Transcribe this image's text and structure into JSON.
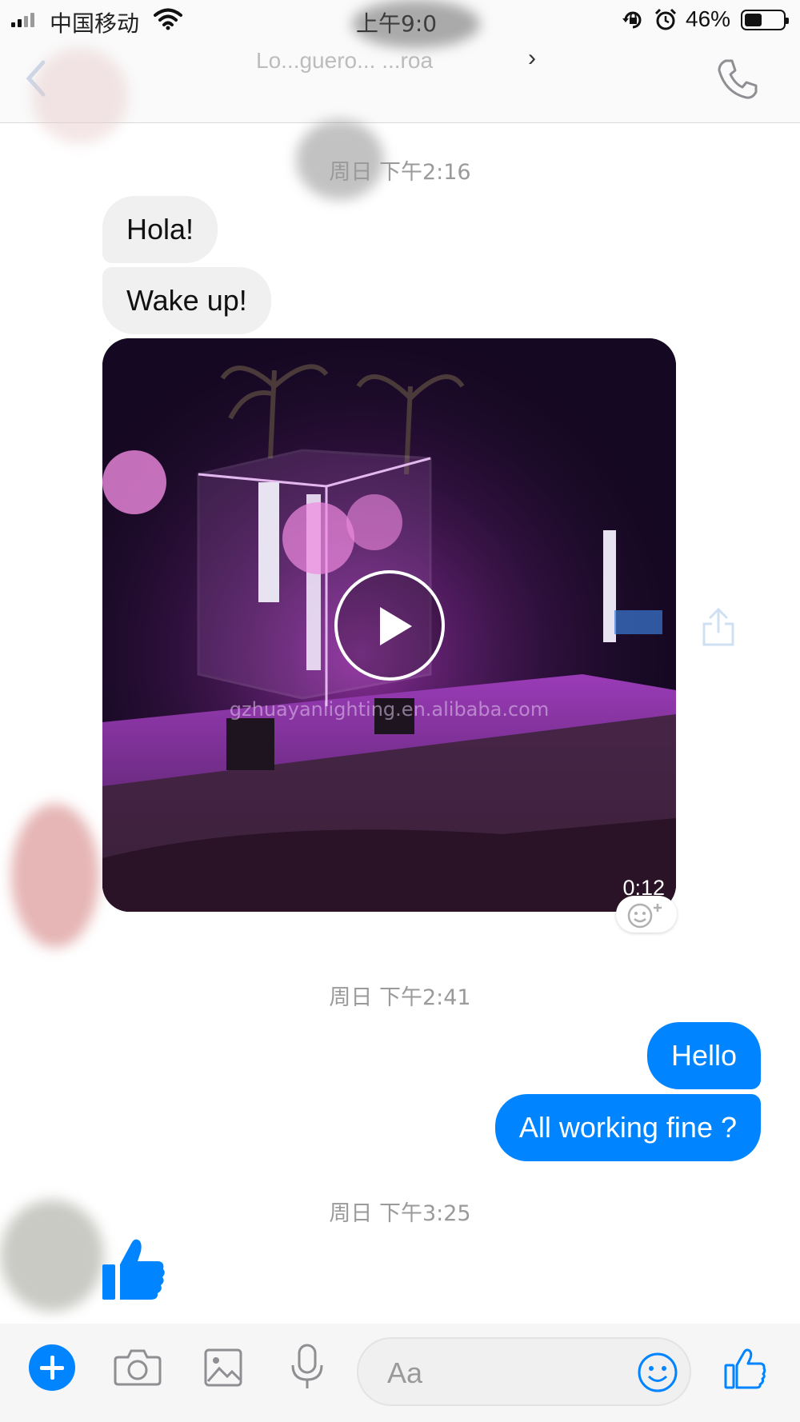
{
  "status_bar": {
    "carrier": "中国移动",
    "time": "上午9:0",
    "battery_percent": "46%",
    "battery_level": 0.46
  },
  "nav": {
    "contact_name": "Lo...guero... ...roa",
    "chevron": "›"
  },
  "messages": {
    "timestamp_1": "周日 下午2:16",
    "incoming_1": "Hola!",
    "incoming_2": "Wake up!",
    "video": {
      "duration": "0:12",
      "watermark": "gzhuayanlighting.en.alibaba.com"
    },
    "timestamp_2": "周日 下午2:41",
    "outgoing_1": "Hello",
    "outgoing_2": "All working fine ?",
    "timestamp_3": "周日 下午3:25"
  },
  "composer": {
    "placeholder": "Aa"
  },
  "colors": {
    "accent": "#0084ff",
    "incoming_bubble": "#f0f0f0",
    "timestamp_text": "#9a9a9a"
  },
  "icons": [
    "signal-icon",
    "wifi-icon",
    "lock-rotation-icon",
    "alarm-icon",
    "battery-icon",
    "back-icon",
    "phone-icon",
    "play-icon",
    "share-icon",
    "add-reaction-icon",
    "thumbs-up-icon",
    "plus-icon",
    "camera-icon",
    "image-icon",
    "microphone-icon",
    "emoji-icon"
  ]
}
